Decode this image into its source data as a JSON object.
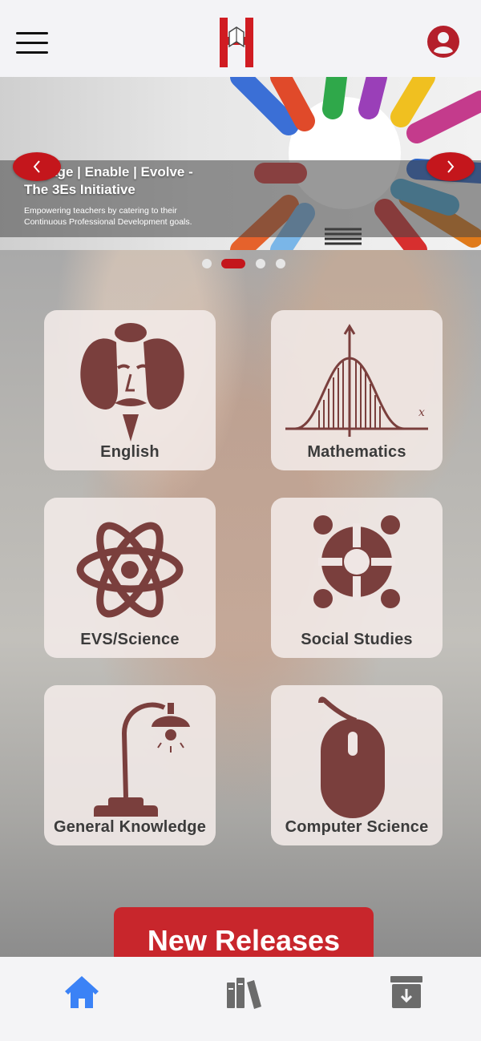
{
  "banner": {
    "title": "Engage | Enable | Evolve - The 3Es Initiative",
    "subtitle": "Empowering teachers by catering to their Continuous Professional Development goals.",
    "slide_count": 4,
    "active_slide": 2
  },
  "subjects": [
    {
      "label": "English",
      "icon": "shakespeare-icon"
    },
    {
      "label": "Mathematics",
      "icon": "bell-curve-graph-icon"
    },
    {
      "label": "EVS/Science",
      "icon": "atom-icon"
    },
    {
      "label": "Social Studies",
      "icon": "people-circle-icon"
    },
    {
      "label": "General Knowledge",
      "icon": "desk-lamp-icon"
    },
    {
      "label": "Computer Science",
      "icon": "computer-mouse-icon"
    }
  ],
  "new_releases_label": "New Releases",
  "tabs": [
    {
      "name": "home",
      "icon": "home-icon",
      "active": true
    },
    {
      "name": "library",
      "icon": "books-icon",
      "active": false
    },
    {
      "name": "downloads",
      "icon": "archive-download-icon",
      "active": false
    }
  ],
  "colors": {
    "brand_red": "#c4161c",
    "icon_brown": "#7a3f3d",
    "active_tab": "#3b82f6",
    "inactive_tab": "#6b6b6b"
  }
}
